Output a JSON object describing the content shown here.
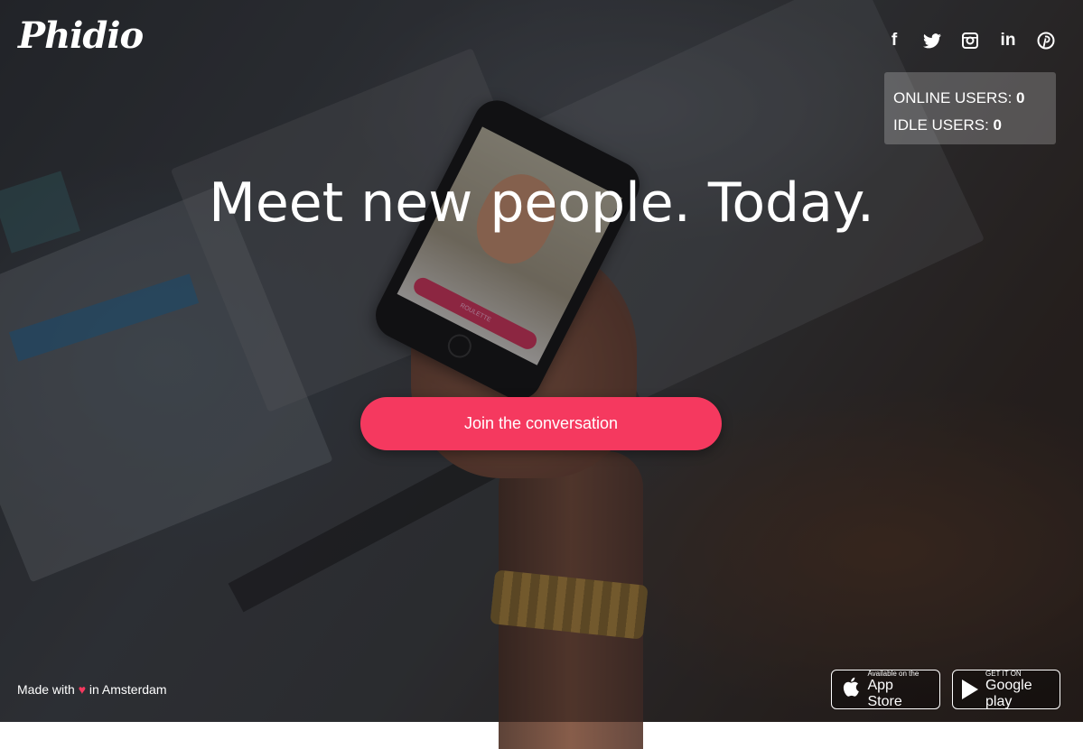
{
  "brand": {
    "logo": "Phidio"
  },
  "social": [
    {
      "name": "facebook",
      "glyph": "f"
    },
    {
      "name": "twitter",
      "glyph": "t"
    },
    {
      "name": "instagram",
      "glyph": "◙"
    },
    {
      "name": "linkedin",
      "glyph": "in"
    },
    {
      "name": "pinterest",
      "glyph": "℗"
    }
  ],
  "stats": {
    "online_label": "ONLINE USERS:",
    "online_value": "0",
    "idle_label": "IDLE USERS:",
    "idle_value": "0"
  },
  "hero": {
    "headline": "Meet new people. Today.",
    "cta_label": "Join the conversation",
    "phone_button": "ROULETTE"
  },
  "footer": {
    "made_with": "Made with",
    "heart": "♥",
    "location": "in Amsterdam"
  },
  "stores": {
    "apple_small": "Available on the",
    "apple_big": "App Store",
    "google_small": "GET IT ON",
    "google_big": "Google play"
  },
  "colors": {
    "accent": "#f5395f"
  }
}
